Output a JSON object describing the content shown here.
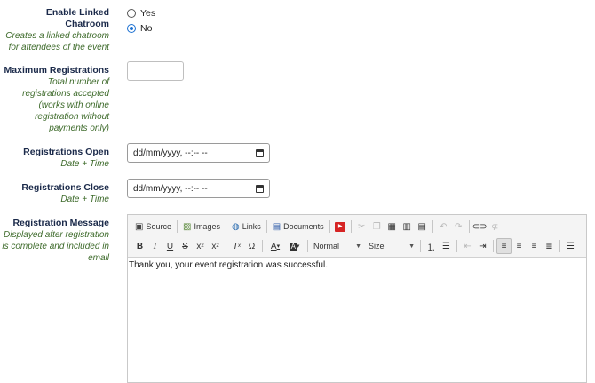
{
  "linked_chatroom": {
    "label": "Enable Linked Chatroom",
    "hint": "Creates a linked chatroom for attendees of the event",
    "options": [
      "Yes",
      "No"
    ],
    "selected": "No"
  },
  "max_registrations": {
    "label": "Maximum Registrations",
    "hint": "Total number of registrations accepted (works with online registration without payments only)",
    "value": ""
  },
  "registrations_open": {
    "label": "Registrations Open",
    "hint": "Date + Time",
    "value": "dd/mm/yyyy, --:-- --"
  },
  "registrations_close": {
    "label": "Registrations Close",
    "hint": "Date + Time",
    "value": "dd/mm/yyyy, --:-- --"
  },
  "registration_message": {
    "label": "Registration Message",
    "hint": "Displayed after registration is complete and included in email",
    "toolbar": {
      "source": "Source",
      "images": "Images",
      "links": "Links",
      "documents": "Documents",
      "format": "Normal",
      "size": "Size"
    },
    "content": "Thank you, your event registration was successful."
  }
}
